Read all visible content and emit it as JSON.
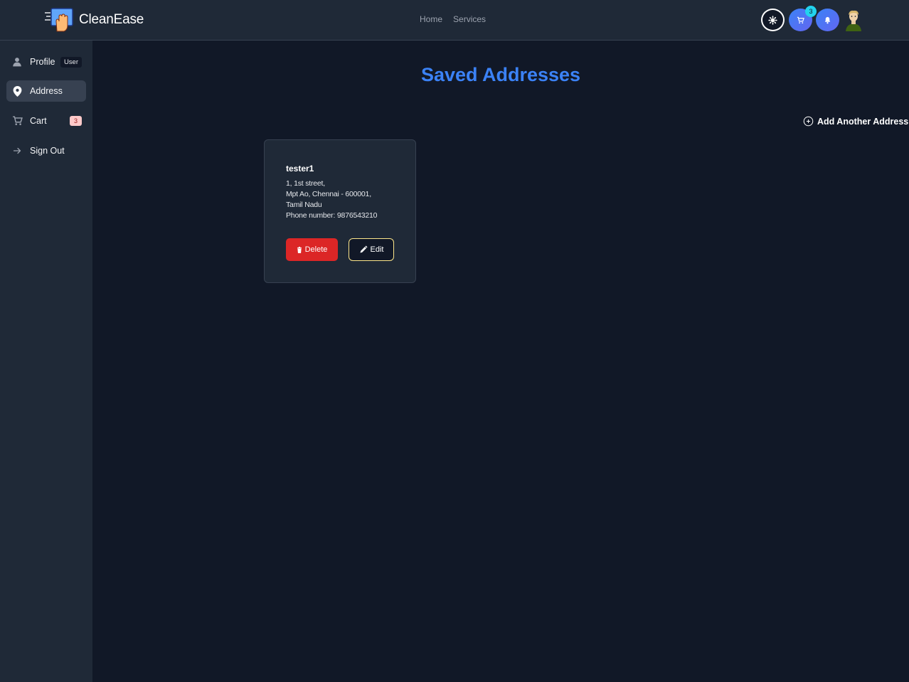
{
  "header": {
    "brand": "CleanEase",
    "nav": [
      "Home",
      "Services"
    ],
    "cart_count": "3",
    "icons": [
      "settings-icon",
      "cart-icon",
      "bell-icon",
      "user-avatar"
    ]
  },
  "sidebar": {
    "items": [
      {
        "label": "Profile",
        "badge": "User",
        "icon": "person-icon"
      },
      {
        "label": "Address",
        "icon": "location-pin-icon",
        "active": true
      },
      {
        "label": "Cart",
        "badge": "3",
        "icon": "cart-icon"
      },
      {
        "label": "Sign Out",
        "icon": "arrow-right-icon"
      }
    ]
  },
  "main": {
    "title": "Saved Addresses",
    "add_label": "Add Another Address",
    "addresses": [
      {
        "name": "tester1",
        "line1": "1, 1st street,",
        "line2": "Mpt Ao, Chennai - 600001,",
        "line3": "Tamil Nadu",
        "phone": "Phone number: 9876543210",
        "delete_label": "Delete",
        "edit_label": "Edit"
      }
    ]
  },
  "colors": {
    "background": "#111827",
    "panel": "#1f2937",
    "accent": "#3b82f6",
    "danger": "#dc2626",
    "edit_border": "#fde68a"
  }
}
